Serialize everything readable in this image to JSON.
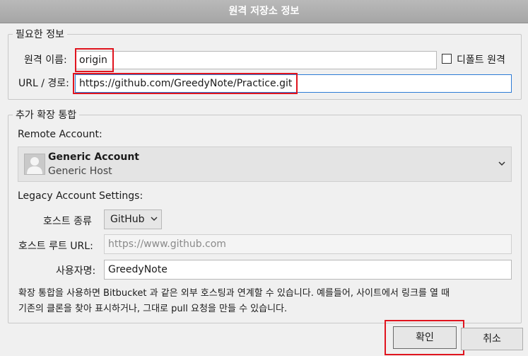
{
  "window": {
    "title": "원격 저장소 정보"
  },
  "required_info": {
    "legend": "필요한 정보",
    "remote_name_label": "원격 이름:",
    "remote_name_value": "origin",
    "default_remote_label": "디폴트 원격",
    "url_label": "URL / 경로:",
    "url_value": "https://github.com/GreedyNote/Practice.git"
  },
  "extension": {
    "legend": "추가 확장 통합",
    "remote_account_label": "Remote Account:",
    "account_name": "Generic Account",
    "account_host": "Generic Host",
    "legacy_label": "Legacy Account Settings:",
    "host_type_label": "호스트 종류",
    "host_type_value": "GitHub",
    "host_root_label": "호스트 루트 URL:",
    "host_root_placeholder": "https://www.github.com",
    "username_label": "사용자명:",
    "username_value": "GreedyNote",
    "note_line1": "확장 통합을 사용하면 Bitbucket 과 같은 외부 호스팅과 연계할 수 있습니다. 예를들어, 사이트에서 링크를 열 때",
    "note_line2": "기존의 클론을 찾아 표시하거나, 그대로 pull 요청을 만들 수 있습니다."
  },
  "buttons": {
    "ok": "확인",
    "cancel": "취소"
  },
  "icons": {
    "dropdown": "chevron-down-icon",
    "avatar": "user-silhouette-icon"
  },
  "colors": {
    "highlight": "#e0141e",
    "focus": "#2c7bd6"
  }
}
